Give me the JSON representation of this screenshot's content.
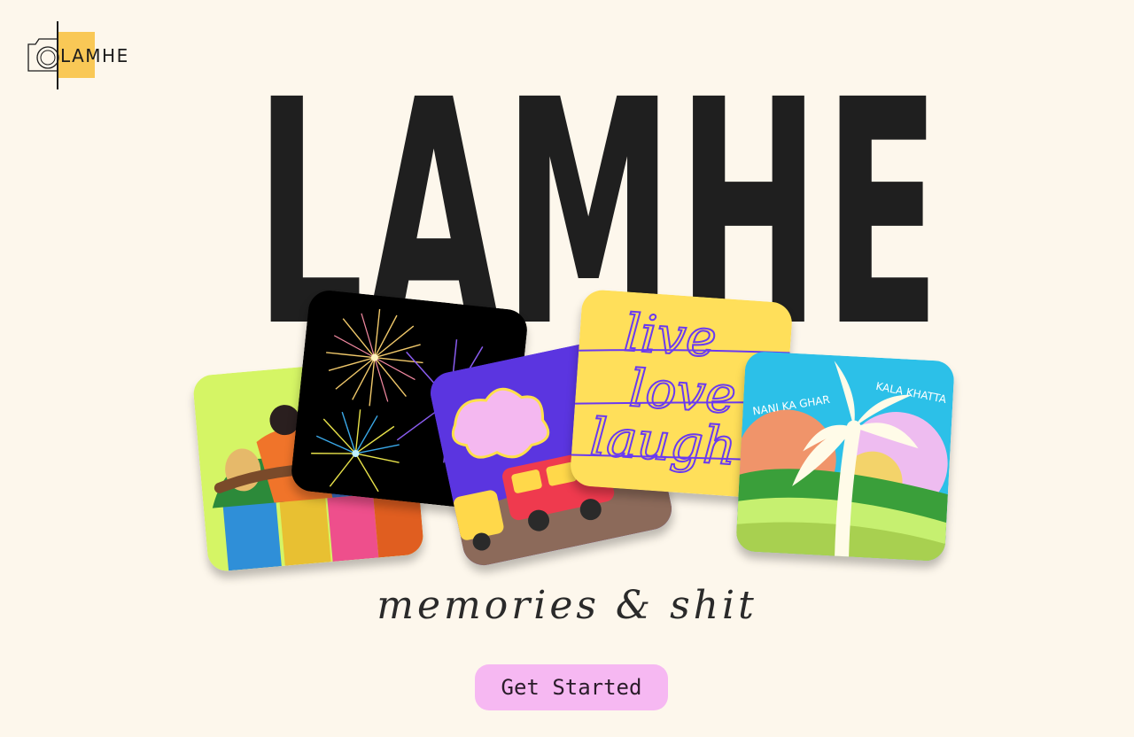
{
  "brand": {
    "logo_text": "LAMHE",
    "logo_color": "#f9c856",
    "icon": "camera-icon"
  },
  "hero": {
    "title": "LAMHE"
  },
  "cards": [
    {
      "name": "friends-hug-card",
      "icon": "friends-illustration"
    },
    {
      "name": "fireworks-card",
      "icon": "fireworks-illustration"
    },
    {
      "name": "bus-trip-card",
      "icon": "bus-illustration"
    },
    {
      "name": "live-love-laugh-card",
      "icon": "lettering-illustration",
      "text": [
        "live",
        "love",
        "laugh"
      ]
    },
    {
      "name": "nani-ka-ghar-card",
      "icon": "palm-tree-illustration",
      "text_left": "NANI KA GHAR",
      "text_right": "KALA KHATTA"
    }
  ],
  "tagline": "memories & shit",
  "cta": {
    "label": "Get Started",
    "color": "#f6b8f2"
  }
}
